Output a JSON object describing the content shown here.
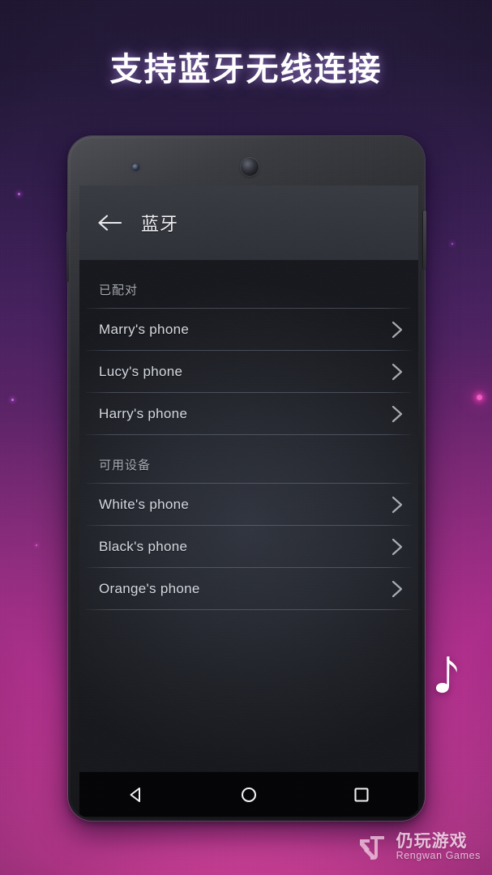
{
  "headline": "支持蓝牙无线连接",
  "phone": {
    "hardware": {
      "sensor": "proximity-sensor",
      "camera": "front-camera",
      "power_button": "power-button",
      "volume_button": "volume-button"
    },
    "appbar": {
      "back_icon": "back-arrow-icon",
      "title": "蓝牙"
    },
    "sections": [
      {
        "label": "已配对",
        "devices": [
          {
            "name": "Marry's phone",
            "chevron": "chevron-right-icon"
          },
          {
            "name": "Lucy's phone",
            "chevron": "chevron-right-icon"
          },
          {
            "name": "Harry's phone",
            "chevron": "chevron-right-icon"
          }
        ]
      },
      {
        "label": "可用设备",
        "devices": [
          {
            "name": "White's phone",
            "chevron": "chevron-right-icon"
          },
          {
            "name": "Black's phone",
            "chevron": "chevron-right-icon"
          },
          {
            "name": "Orange's phone",
            "chevron": "chevron-right-icon"
          }
        ]
      }
    ],
    "navbar": {
      "back": "android-back-triangle-icon",
      "home": "android-home-circle-icon",
      "recents": "android-recents-square-icon"
    }
  },
  "decor": {
    "music_note": "music-note-icon"
  },
  "watermark": {
    "logo": "rengwan-logo-icon",
    "cn": "仍玩游戏",
    "en": "Rengwan Games"
  },
  "colors": {
    "bg_top": "#221936",
    "bg_mid": "#5d2468",
    "bg_bottom": "#c5449e",
    "screen_bg": "#272a32",
    "appbar_bg": "#34363d",
    "text_primary": "#d5d9e0",
    "text_secondary": "#a7abb4",
    "accent_pink": "#d93fa5"
  }
}
